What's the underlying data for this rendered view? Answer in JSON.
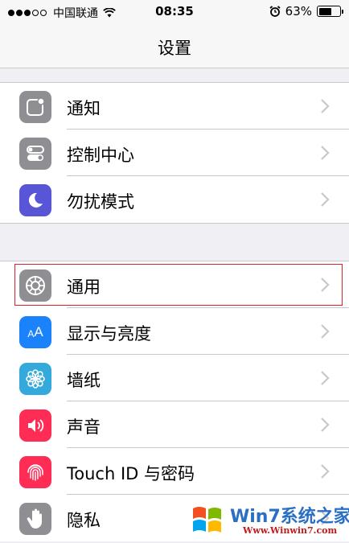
{
  "status_bar": {
    "carrier": "中国联通",
    "time": "08:35",
    "battery": "63%",
    "battery_level": 0.63
  },
  "nav": {
    "title": "设置"
  },
  "groups": [
    {
      "items": [
        {
          "label": "通知",
          "icon": "notifications-icon",
          "color": "#8e8e93"
        },
        {
          "label": "控制中心",
          "icon": "control-center-icon",
          "color": "#8e8e93"
        },
        {
          "label": "勿扰模式",
          "icon": "moon-icon",
          "color": "#5856d6"
        }
      ]
    },
    {
      "items": [
        {
          "label": "通用",
          "icon": "gear-icon",
          "color": "#8e8e93",
          "highlighted": true
        },
        {
          "label": "显示与亮度",
          "icon": "text-size-icon",
          "color": "#1a82fb"
        },
        {
          "label": "墙纸",
          "icon": "wallpaper-icon",
          "color": "#34aadc"
        },
        {
          "label": "声音",
          "icon": "speaker-icon",
          "color": "#ff2d55"
        },
        {
          "label": "Touch ID 与密码",
          "icon": "fingerprint-icon",
          "color": "#ff2d55"
        },
        {
          "label": "隐私",
          "icon": "hand-icon",
          "color": "#8e8e93"
        }
      ]
    }
  ],
  "watermark": {
    "brand": "Win7系统之家",
    "url": "Www.Winwin7.com"
  }
}
